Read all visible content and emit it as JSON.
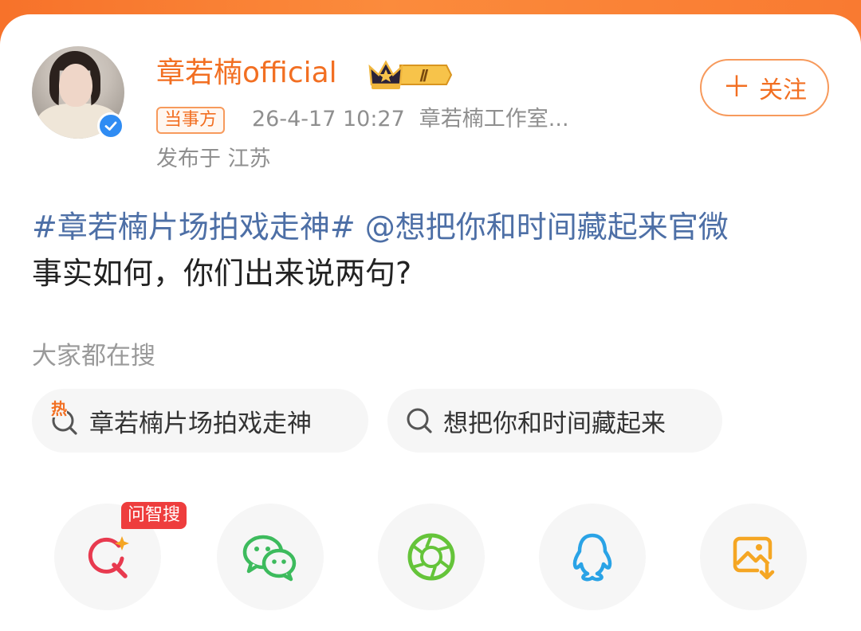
{
  "user": {
    "name": "章若楠official",
    "level_badge": "Ⅱ",
    "party_tag": "当事方",
    "timestamp": "26-4-17 10:27",
    "source": "章若楠工作室...",
    "location": "发布于 江苏",
    "follow_plus": "＋",
    "follow_label": "关注"
  },
  "post": {
    "topic": "#章若楠片场拍戏走神#",
    "mention": "@想把你和时间藏起来官微",
    "text": "事实如何，你们出来说两句?"
  },
  "search": {
    "heading": "大家都在搜",
    "chips": [
      {
        "hot_mark": "热",
        "label": "章若楠片场拍戏走神"
      },
      {
        "label": "想把你和时间藏起来"
      }
    ]
  },
  "share": {
    "ai_badge": "问智搜",
    "items": [
      {
        "icon": "ai-search-icon",
        "color": "#e83a4f"
      },
      {
        "icon": "wechat-icon",
        "color": "#3dbb5d"
      },
      {
        "icon": "moments-icon",
        "color": "#65c43a"
      },
      {
        "icon": "qq-icon",
        "color": "#2aa3e6"
      },
      {
        "icon": "save-image-icon",
        "color": "#f5a623"
      }
    ]
  },
  "colors": {
    "brand_orange": "#f26f22",
    "link_blue": "#4d6fa6",
    "muted_gray": "#8f8f8f"
  }
}
